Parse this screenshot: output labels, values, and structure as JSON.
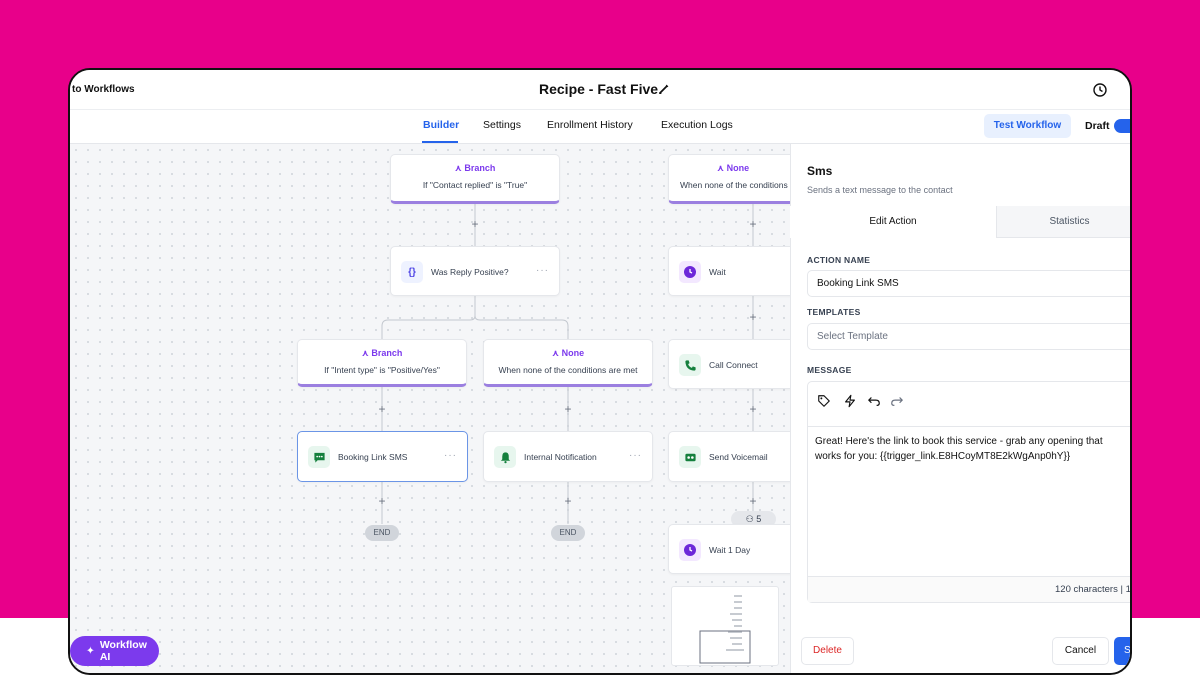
{
  "header": {
    "back_label": "to Workflows",
    "title": "Recipe - Fast Five"
  },
  "tabs": [
    {
      "label": "Builder",
      "active": true
    },
    {
      "label": "Settings"
    },
    {
      "label": "Enrollment History"
    },
    {
      "label": "Execution Logs"
    }
  ],
  "toolbar": {
    "test_label": "Test Workflow",
    "status_label": "Draft"
  },
  "canvas": {
    "branch_contact": {
      "title": "Branch",
      "condition": "If \"Contact replied\" is \"True\""
    },
    "branch_none_top": {
      "title": "None",
      "condition": "When none of the conditions are met"
    },
    "reply_check": {
      "label": "Was Reply Positive?"
    },
    "branch_intent": {
      "title": "Branch",
      "condition": "If \"Intent type\" is \"Positive/Yes\""
    },
    "branch_none_mid": {
      "title": "None",
      "condition": "When none of the conditions are met"
    },
    "booking_sms": {
      "label": "Booking Link SMS"
    },
    "internal_notification": {
      "label": "Internal Notification"
    },
    "wait": {
      "label": "Wait"
    },
    "call_connect": {
      "label": "Call Connect"
    },
    "send_voicemail": {
      "label": "Send Voicemail"
    },
    "wait_1_day": {
      "label": "Wait 1 Day"
    },
    "end_label": "END",
    "contacts_count": "5",
    "ai_button": "Workflow AI"
  },
  "panel": {
    "title": "Sms",
    "subtitle": "Sends a text message to the contact",
    "tab_edit": "Edit Action",
    "tab_stats": "Statistics",
    "action_name_label": "ACTION NAME",
    "action_name_value": "Booking Link SMS",
    "templates_label": "TEMPLATES",
    "templates_placeholder": "Select Template",
    "message_label": "MESSAGE",
    "message_text": "Great! Here's the link to book this service - grab any opening that\nworks for you: {{trigger_link.E8HCoyMT8E2kWgAnp0hY}}",
    "char_count": "120 characters | 1",
    "delete_label": "Delete",
    "cancel_label": "Cancel",
    "save_label": "S"
  },
  "colors": {
    "background": "#e8008a",
    "accent": "#2563eb",
    "branch": "#7c3aed",
    "danger": "#dc2626"
  }
}
